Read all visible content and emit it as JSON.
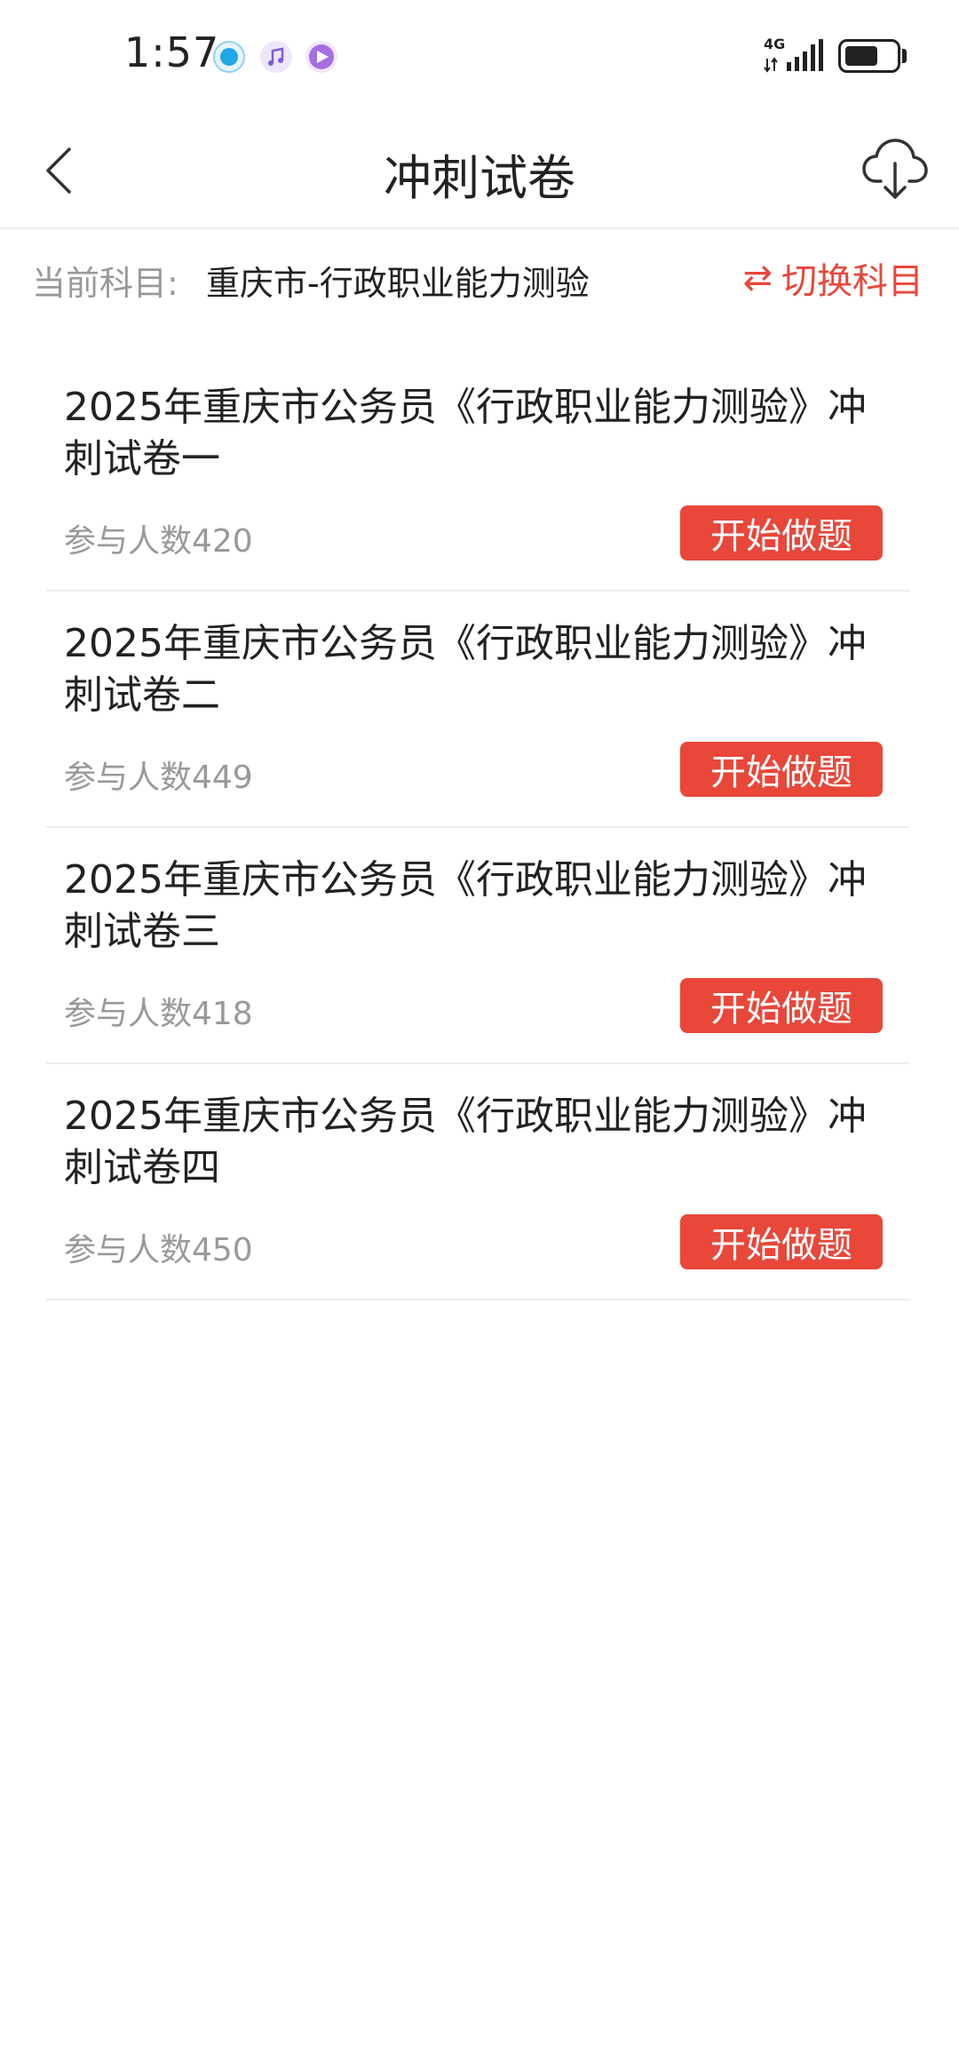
{
  "status_bar": {
    "time": "1:57",
    "network": "4G",
    "app_icons": [
      "shield-check-icon",
      "music-note-icon",
      "triangle-app-icon"
    ]
  },
  "header": {
    "title": "冲刺试卷",
    "back_icon": "chevron-left-icon",
    "download_icon": "cloud-download-icon"
  },
  "subject": {
    "label": "当前科目:",
    "value": "重庆市-行政职业能力测验",
    "switch_label": "切换科目",
    "switch_icon": "swap-arrows-icon"
  },
  "exams": [
    {
      "title": "2025年重庆市公务员《行政职业能力测验》冲刺试卷一",
      "count": "参与人数420",
      "button": "开始做题"
    },
    {
      "title": "2025年重庆市公务员《行政职业能力测验》冲刺试卷二",
      "count": "参与人数449",
      "button": "开始做题"
    },
    {
      "title": "2025年重庆市公务员《行政职业能力测验》冲刺试卷三",
      "count": "参与人数418",
      "button": "开始做题"
    },
    {
      "title": "2025年重庆市公务员《行政职业能力测验》冲刺试卷四",
      "count": "参与人数450",
      "button": "开始做题"
    }
  ],
  "colors": {
    "accent": "#e8473a",
    "muted_text": "#999999",
    "divider": "#ededed"
  }
}
